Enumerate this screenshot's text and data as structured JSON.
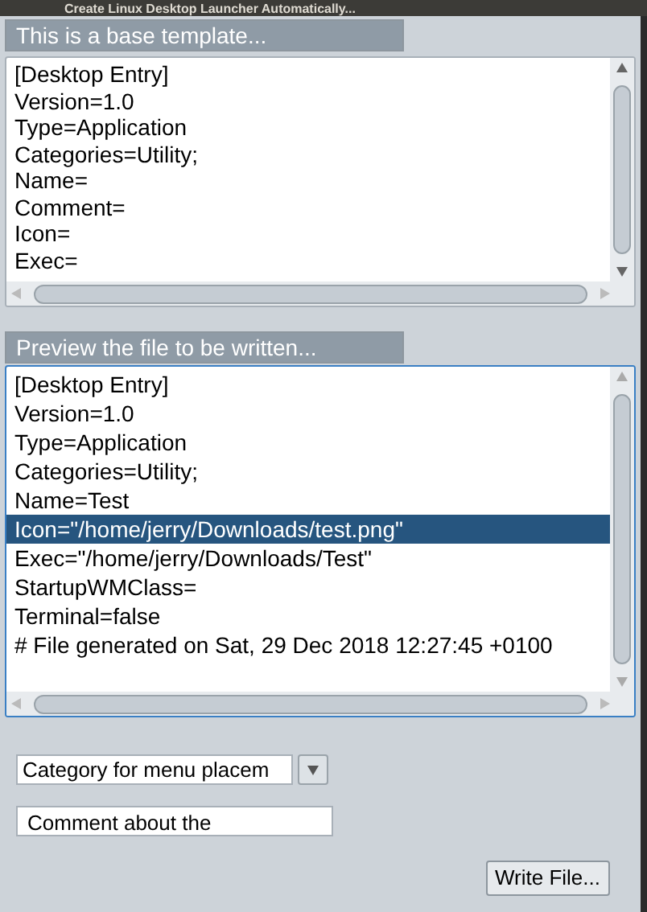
{
  "window": {
    "title": "Create Linux Desktop Launcher Automatically..."
  },
  "template": {
    "label": "This is a base template...",
    "lines": [
      {
        "text": "[Desktop Entry]",
        "selected": false
      },
      {
        "text": "Version=1.0",
        "selected": false
      },
      {
        "text": "Type=Application",
        "selected": false
      },
      {
        "text": "Categories=Utility;",
        "selected": false
      },
      {
        "text": "Name=",
        "selected": false
      },
      {
        "text": "Comment=",
        "selected": false
      },
      {
        "text": "Icon=",
        "selected": false
      },
      {
        "text": "Exec=",
        "selected": false
      }
    ]
  },
  "preview": {
    "label": "Preview the file to be written...",
    "lines": [
      {
        "text": "[Desktop Entry]",
        "selected": false
      },
      {
        "text": "Version=1.0",
        "selected": false
      },
      {
        "text": "Type=Application",
        "selected": false
      },
      {
        "text": "Categories=Utility;",
        "selected": false
      },
      {
        "text": "Name=Test",
        "selected": false
      },
      {
        "text": "Icon=\"/home/jerry/Downloads/test.png\"",
        "selected": true
      },
      {
        "text": "Exec=\"/home/jerry/Downloads/Test\"",
        "selected": false
      },
      {
        "text": "StartupWMClass=",
        "selected": false
      },
      {
        "text": "Terminal=false",
        "selected": false
      },
      {
        "text": "# File generated on Sat, 29 Dec 2018 12:27:45 +0100",
        "selected": false
      }
    ]
  },
  "category": {
    "value": "Category for menu placem"
  },
  "comment": {
    "value": "Comment about the"
  },
  "buttons": [
    "Write File..."
  ]
}
